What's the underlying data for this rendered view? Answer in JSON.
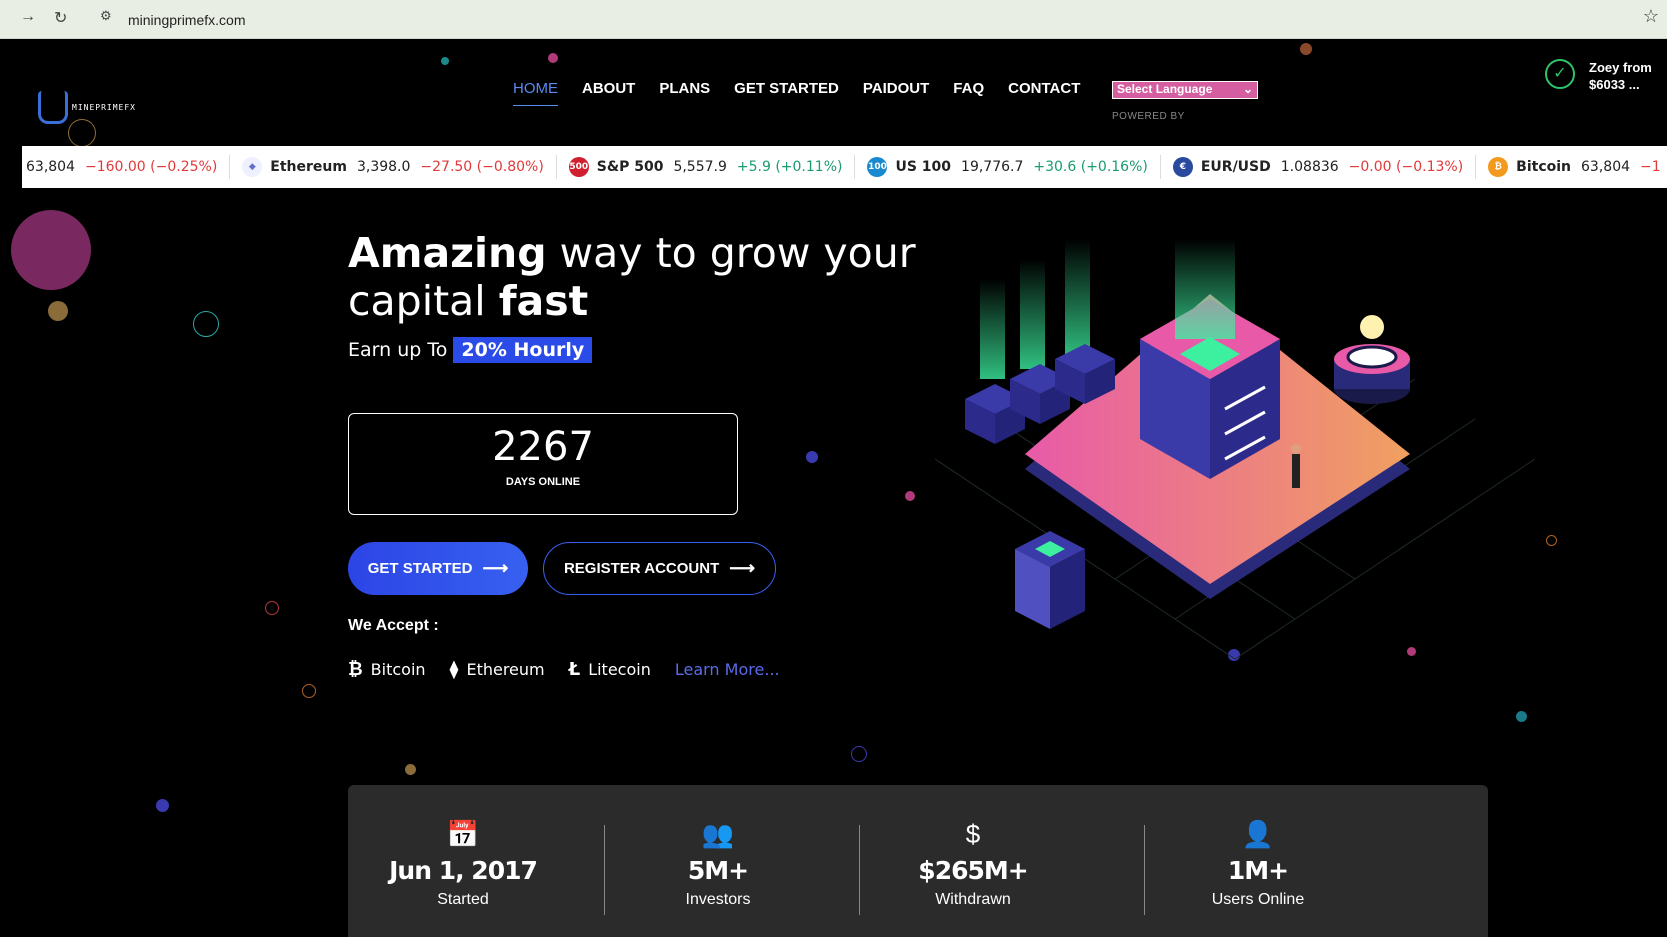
{
  "browser": {
    "url": "miningprimefx.com"
  },
  "logo": {
    "text": "MINEPRIMEFX"
  },
  "nav": {
    "items": [
      "HOME",
      "ABOUT",
      "PLANS",
      "GET STARTED",
      "PAIDOUT",
      "FAQ",
      "CONTACT"
    ],
    "language_select": "Select Language",
    "powered_by": "POWERED BY"
  },
  "notification": {
    "line1": "Zoey from",
    "line2": "$6033 ..."
  },
  "ticker": [
    {
      "name": "",
      "price": "63,804",
      "change": "−160.00 (−0.25%)",
      "dir": "neg",
      "icon": ""
    },
    {
      "name": "Ethereum",
      "price": "3,398.0",
      "change": "−27.50 (−0.80%)",
      "dir": "neg",
      "icon": "eth"
    },
    {
      "name": "S&P 500",
      "price": "5,557.9",
      "change": "+5.9 (+0.11%)",
      "dir": "pos",
      "icon": "500"
    },
    {
      "name": "US 100",
      "price": "19,776.7",
      "change": "+30.6 (+0.16%)",
      "dir": "pos",
      "icon": "100"
    },
    {
      "name": "EUR/USD",
      "price": "1.08836",
      "change": "−0.00 (−0.13%)",
      "dir": "neg",
      "icon": "eu"
    },
    {
      "name": "Bitcoin",
      "price": "63,804",
      "change": "−1",
      "dir": "neg",
      "icon": "btc"
    }
  ],
  "hero": {
    "headline_bold1": "Amazing",
    "headline_mid": " way to grow your",
    "headline_line2": "capital ",
    "headline_bold2": "fast",
    "earn_prefix": "Earn up To",
    "earn_highlight": "20% Hourly",
    "counter_value": "2267",
    "counter_label": "DAYS ONLINE",
    "btn_get_started": "GET STARTED",
    "btn_register": "REGISTER ACCOUNT",
    "accept_label": "We Accept :",
    "coins": [
      "Bitcoin",
      "Ethereum",
      "Litecoin"
    ],
    "learn_more": "Learn More..."
  },
  "stats": [
    {
      "value": "Jun 1, 2017",
      "label": "Started",
      "icon": "calendar-icon"
    },
    {
      "value": "5M+",
      "label": "Investors",
      "icon": "users-icon"
    },
    {
      "value": "$265M+",
      "label": "Withdrawn",
      "icon": "dollar-icon"
    },
    {
      "value": "1M+",
      "label": "Users Online",
      "icon": "user-plus-icon"
    }
  ],
  "colors": {
    "accent": "#2c45e6",
    "positive": "#1a9b71",
    "negative": "#e03a3a",
    "lang_bg": "#d45ea0"
  }
}
